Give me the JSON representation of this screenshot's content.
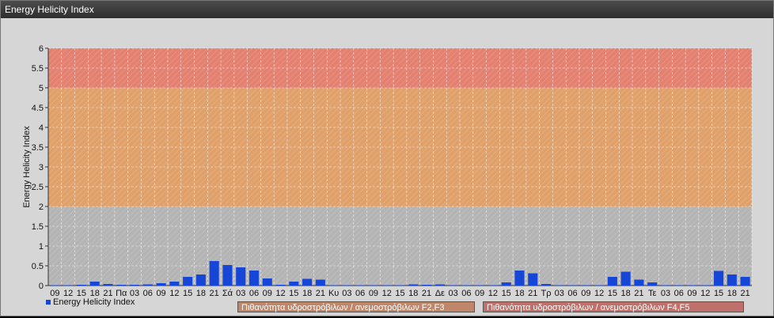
{
  "window": {
    "title": "Energy Helicity Index"
  },
  "colors": {
    "band_low": "#b4b4b4",
    "band_mid": "#e0a06a",
    "band_high": "#e38070",
    "bar": "#1646d8",
    "grid": "#ffffff"
  },
  "chart_data": {
    "type": "bar",
    "title": "",
    "xlabel": "",
    "ylabel": "Energy Helicity Index",
    "ylim": [
      0,
      6
    ],
    "yticks": [
      "0",
      "0.5",
      "1",
      "1.5",
      "2",
      "2.5",
      "3",
      "3.5",
      "4",
      "4.5",
      "5",
      "5.5",
      "6"
    ],
    "grid": true,
    "legend_position": "bottom-left",
    "categories": [
      "09",
      "12",
      "15",
      "18",
      "21",
      "Πα",
      "03",
      "06",
      "09",
      "12",
      "15",
      "18",
      "21",
      "Σά",
      "03",
      "06",
      "09",
      "12",
      "15",
      "18",
      "21",
      "Κυ",
      "03",
      "06",
      "09",
      "12",
      "15",
      "18",
      "21",
      "Δε",
      "03",
      "06",
      "09",
      "12",
      "15",
      "18",
      "21",
      "Τρ",
      "03",
      "06",
      "09",
      "12",
      "15",
      "18",
      "21",
      "Τε",
      "03",
      "06",
      "09",
      "12",
      "15",
      "18",
      "21"
    ],
    "series": [
      {
        "name": "Energy Helicity Index",
        "values": [
          0.01,
          0.01,
          0.02,
          0.1,
          0.04,
          0.02,
          0.02,
          0.03,
          0.06,
          0.1,
          0.22,
          0.28,
          0.62,
          0.52,
          0.46,
          0.38,
          0.18,
          0.02,
          0.1,
          0.17,
          0.15,
          0.01,
          0.01,
          0.01,
          0.01,
          0.01,
          0.01,
          0.03,
          0.02,
          0.03,
          0.01,
          0.01,
          0.01,
          0.01,
          0.08,
          0.38,
          0.31,
          0.04,
          0.01,
          0.01,
          0.01,
          0.01,
          0.22,
          0.35,
          0.15,
          0.08,
          0.01,
          0.01,
          0.01,
          0.01,
          0.37,
          0.28,
          0.22
        ]
      }
    ],
    "bands": [
      {
        "from": 0,
        "to": 2,
        "label": ""
      },
      {
        "from": 2,
        "to": 5,
        "label": "Πιθανότητα υδροστρόβιλων / ανεμοστρόβιλων F2,F3"
      },
      {
        "from": 5,
        "to": 6,
        "label": "Πιθανότητα υδροστρόβιλων / ανεμοστρόβιλων F4,F5"
      }
    ]
  }
}
